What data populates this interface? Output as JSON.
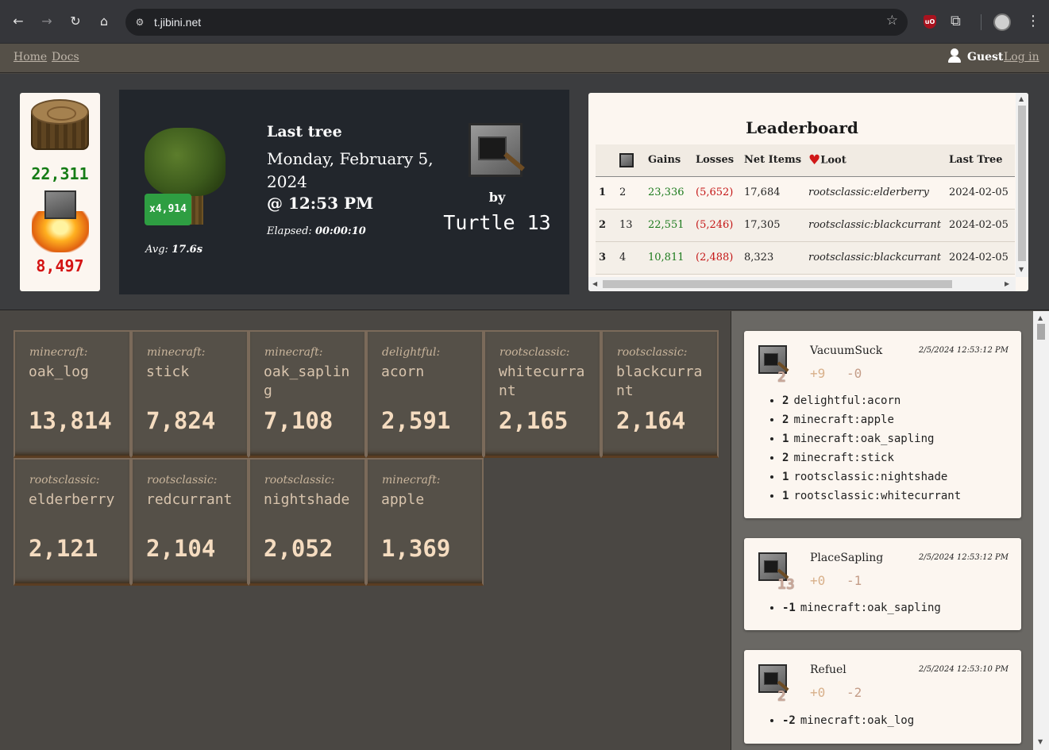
{
  "browser": {
    "url": "t.jibini.net"
  },
  "nav": {
    "home": "Home",
    "docs": "Docs",
    "user": "Guest",
    "login": "Log in"
  },
  "counters": {
    "logs": "22,311",
    "burned": "8,497"
  },
  "last_tree": {
    "badge": "x4,914",
    "avg_label": "Avg:",
    "avg_value": "17.6s",
    "title": "Last tree",
    "date": "Monday, February 5, 2024",
    "time_prefix": "@",
    "time": "12:53 PM",
    "elapsed_label": "Elapsed:",
    "elapsed_value": "00:00:10",
    "by": "by",
    "turtle": "Turtle 13"
  },
  "leaderboard": {
    "title": "Leaderboard",
    "columns": [
      "",
      "",
      "Gains",
      "Losses",
      "Net Items",
      "Loot",
      "Last Tree"
    ],
    "rows": [
      {
        "rank": "1",
        "turtle": "2",
        "gains": "23,336",
        "losses": "(5,652)",
        "net": "17,684",
        "loot": "rootsclassic:elderberry",
        "last": "2024-02-05"
      },
      {
        "rank": "2",
        "turtle": "13",
        "gains": "22,551",
        "losses": "(5,246)",
        "net": "17,305",
        "loot": "rootsclassic:blackcurrant",
        "last": "2024-02-05"
      },
      {
        "rank": "3",
        "turtle": "4",
        "gains": "10,811",
        "losses": "(2,488)",
        "net": "8,323",
        "loot": "rootsclassic:blackcurrant",
        "last": "2024-02-05"
      }
    ]
  },
  "inventory": [
    {
      "ns": "minecraft:",
      "name": "oak_log",
      "count": "13,814"
    },
    {
      "ns": "minecraft:",
      "name": "stick",
      "count": "7,824"
    },
    {
      "ns": "minecraft:",
      "name": "oak_sapling",
      "count": "7,108"
    },
    {
      "ns": "delightful:",
      "name": "acorn",
      "count": "2,591"
    },
    {
      "ns": "rootsclassic:",
      "name": "whitecurrant",
      "count": "2,165"
    },
    {
      "ns": "rootsclassic:",
      "name": "blackcurrant",
      "count": "2,164"
    },
    {
      "ns": "rootsclassic:",
      "name": "elderberry",
      "count": "2,121"
    },
    {
      "ns": "rootsclassic:",
      "name": "redcurrant",
      "count": "2,104"
    },
    {
      "ns": "rootsclassic:",
      "name": "nightshade",
      "count": "2,052"
    },
    {
      "ns": "minecraft:",
      "name": "apple",
      "count": "1,369"
    }
  ],
  "events": [
    {
      "turtle": "2",
      "name": "VacuumSuck",
      "time": "2/5/2024 12:53:12 PM",
      "plus": "+9",
      "minus": "-0",
      "items": [
        {
          "qty": "2",
          "item": "delightful:acorn"
        },
        {
          "qty": "2",
          "item": "minecraft:apple"
        },
        {
          "qty": "1",
          "item": "minecraft:oak_sapling"
        },
        {
          "qty": "2",
          "item": "minecraft:stick"
        },
        {
          "qty": "1",
          "item": "rootsclassic:nightshade"
        },
        {
          "qty": "1",
          "item": "rootsclassic:whitecurrant"
        }
      ]
    },
    {
      "turtle": "13",
      "name": "PlaceSapling",
      "time": "2/5/2024 12:53:12 PM",
      "plus": "+0",
      "minus": "-1",
      "items": [
        {
          "qty": "-1",
          "item": "minecraft:oak_sapling"
        }
      ]
    },
    {
      "turtle": "2",
      "name": "Refuel",
      "time": "2/5/2024 12:53:10 PM",
      "plus": "+0",
      "minus": "-2",
      "items": [
        {
          "qty": "-2",
          "item": "minecraft:oak_log"
        }
      ]
    }
  ]
}
